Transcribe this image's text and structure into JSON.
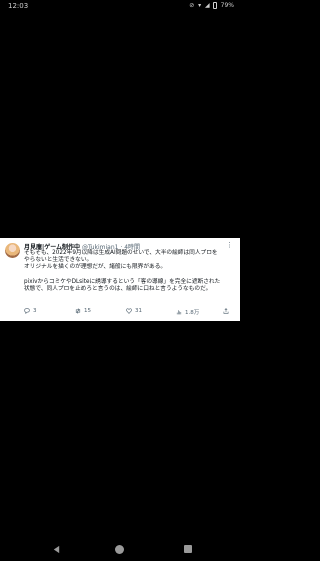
{
  "status_bar": {
    "time": "12:03",
    "icons": [
      "mute-icon",
      "wifi-icon",
      "signal-icon",
      "battery-icon"
    ],
    "battery": "79%"
  },
  "tweet": {
    "author_name": "月見庵|ゲーム制作中",
    "handle": "@Tukimian1",
    "time": "4時間",
    "lines": [
      "そもそも、2022年9月以降は生成AI問題のせいで、大半の絵師は同人プロを",
      "やらないと生活できない。",
      "オリジナルを描くのが理想だが、諸般にも限界がある。",
      "",
      "pixivからコミケやDLsiteに誘導するという「客の導線」を完全に遮断された",
      "状態で、同人プロを止めろと言うのは、絵師に口ねと言うようなものだ。"
    ],
    "actions": {
      "replies": "3",
      "retweets": "15",
      "likes": "31",
      "views": "1.8万"
    }
  },
  "colors": {
    "background": "#000000",
    "card": "#ffffff",
    "text": "#0f1419",
    "muted": "#536471"
  }
}
